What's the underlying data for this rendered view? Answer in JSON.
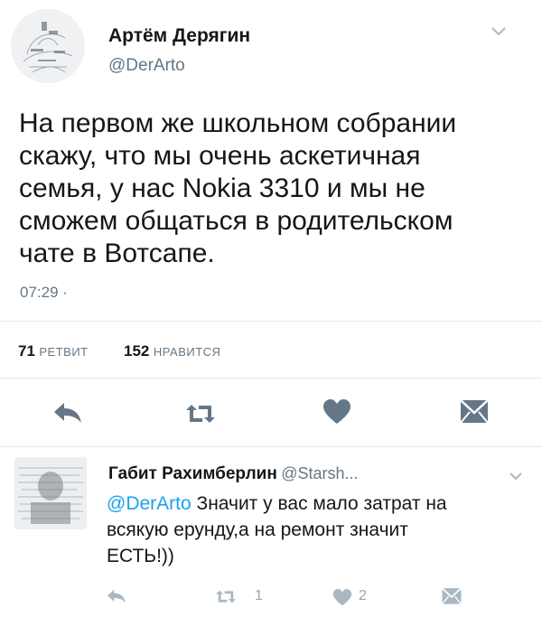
{
  "tweet": {
    "author_name": "Артём Дерягин",
    "author_handle": "@DerArto",
    "text_lines": [
      "На первом же школьном собрании",
      "скажу, что мы очень аскетичная",
      "семья, у нас Nokia 3310 и мы не",
      "сможем общаться в родительском",
      "чате в Вотсапе."
    ],
    "time": "07:29 ·",
    "retweets_count": "71",
    "retweets_label": "РЕТВИТ",
    "likes_count": "152",
    "likes_label": "НРАВИТСЯ",
    "actions": [
      "reply-icon",
      "retweet-icon",
      "like-icon",
      "message-icon"
    ]
  },
  "reply": {
    "author_name": "Габит Рахимберлин",
    "author_handle": "@Starsh...",
    "mention": "@DerArto",
    "text_lines": [
      " Значит у вас мало затрат на",
      "всякую ерунду,а на ремонт значит",
      "ЕСТЬ!))"
    ],
    "retweets_count": "1",
    "likes_count": "2",
    "actions": [
      "reply-icon",
      "retweet-icon",
      "like-icon",
      "message-icon"
    ]
  },
  "colors": {
    "text": "#14171a",
    "secondary": "#657786",
    "accent": "#1da1f2",
    "icon": "#657786",
    "icon_light": "#aab8c2",
    "divider": "#e1e8ed"
  }
}
